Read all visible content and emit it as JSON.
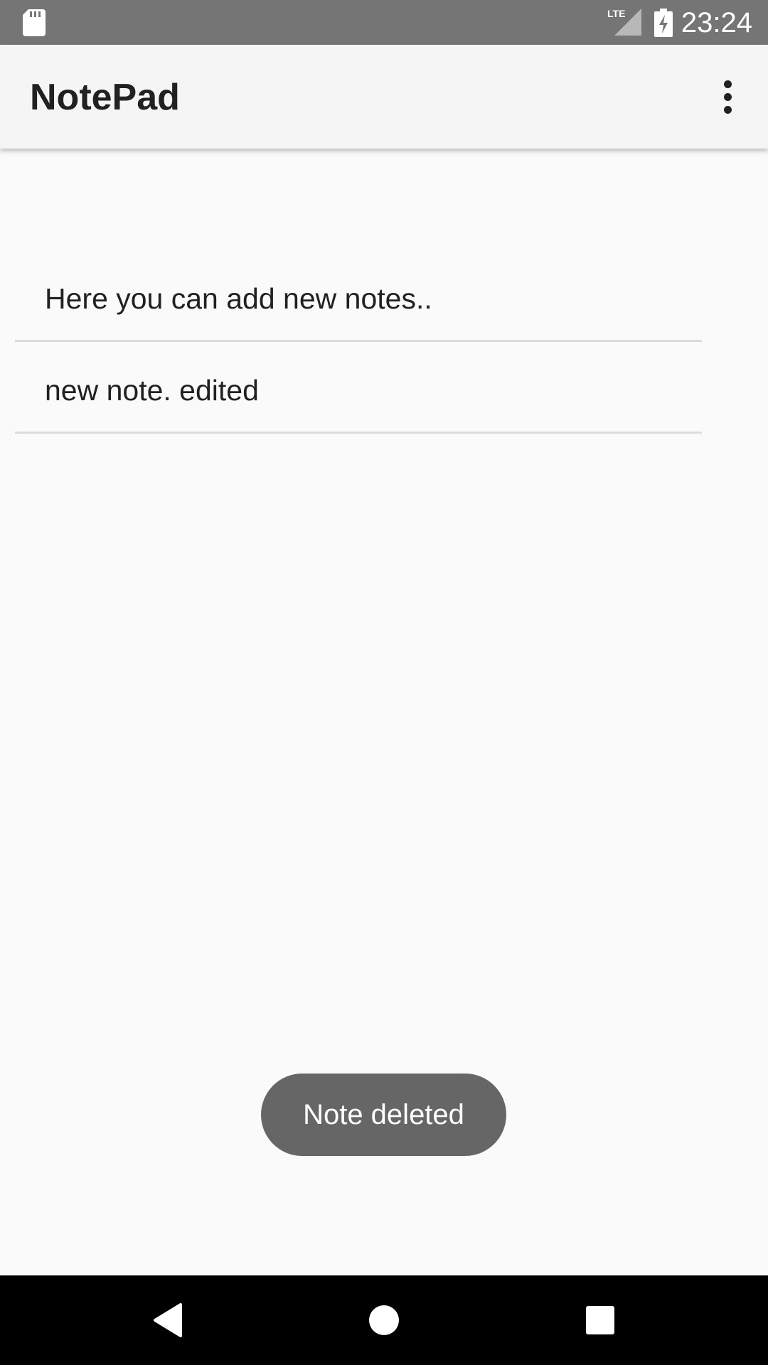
{
  "status_bar": {
    "time": "23:24",
    "network_label": "LTE",
    "icons": [
      "sd-card-icon",
      "lte-signal-icon",
      "battery-charging-icon"
    ]
  },
  "app_bar": {
    "title": "NotePad",
    "overflow_icon": "more-vert-icon"
  },
  "notes": [
    {
      "text": "Here you can add new notes.."
    },
    {
      "text": "new note. edited"
    }
  ],
  "toast": {
    "message": "Note deleted"
  },
  "nav_bar": {
    "icons": [
      "back-icon",
      "home-icon",
      "recents-icon"
    ]
  },
  "colors": {
    "status_bar": "#757575",
    "app_bar": "#f5f5f5",
    "background": "#fafafa",
    "divider": "#dcdcdc",
    "toast": "#666666",
    "nav_bar": "#000000"
  }
}
